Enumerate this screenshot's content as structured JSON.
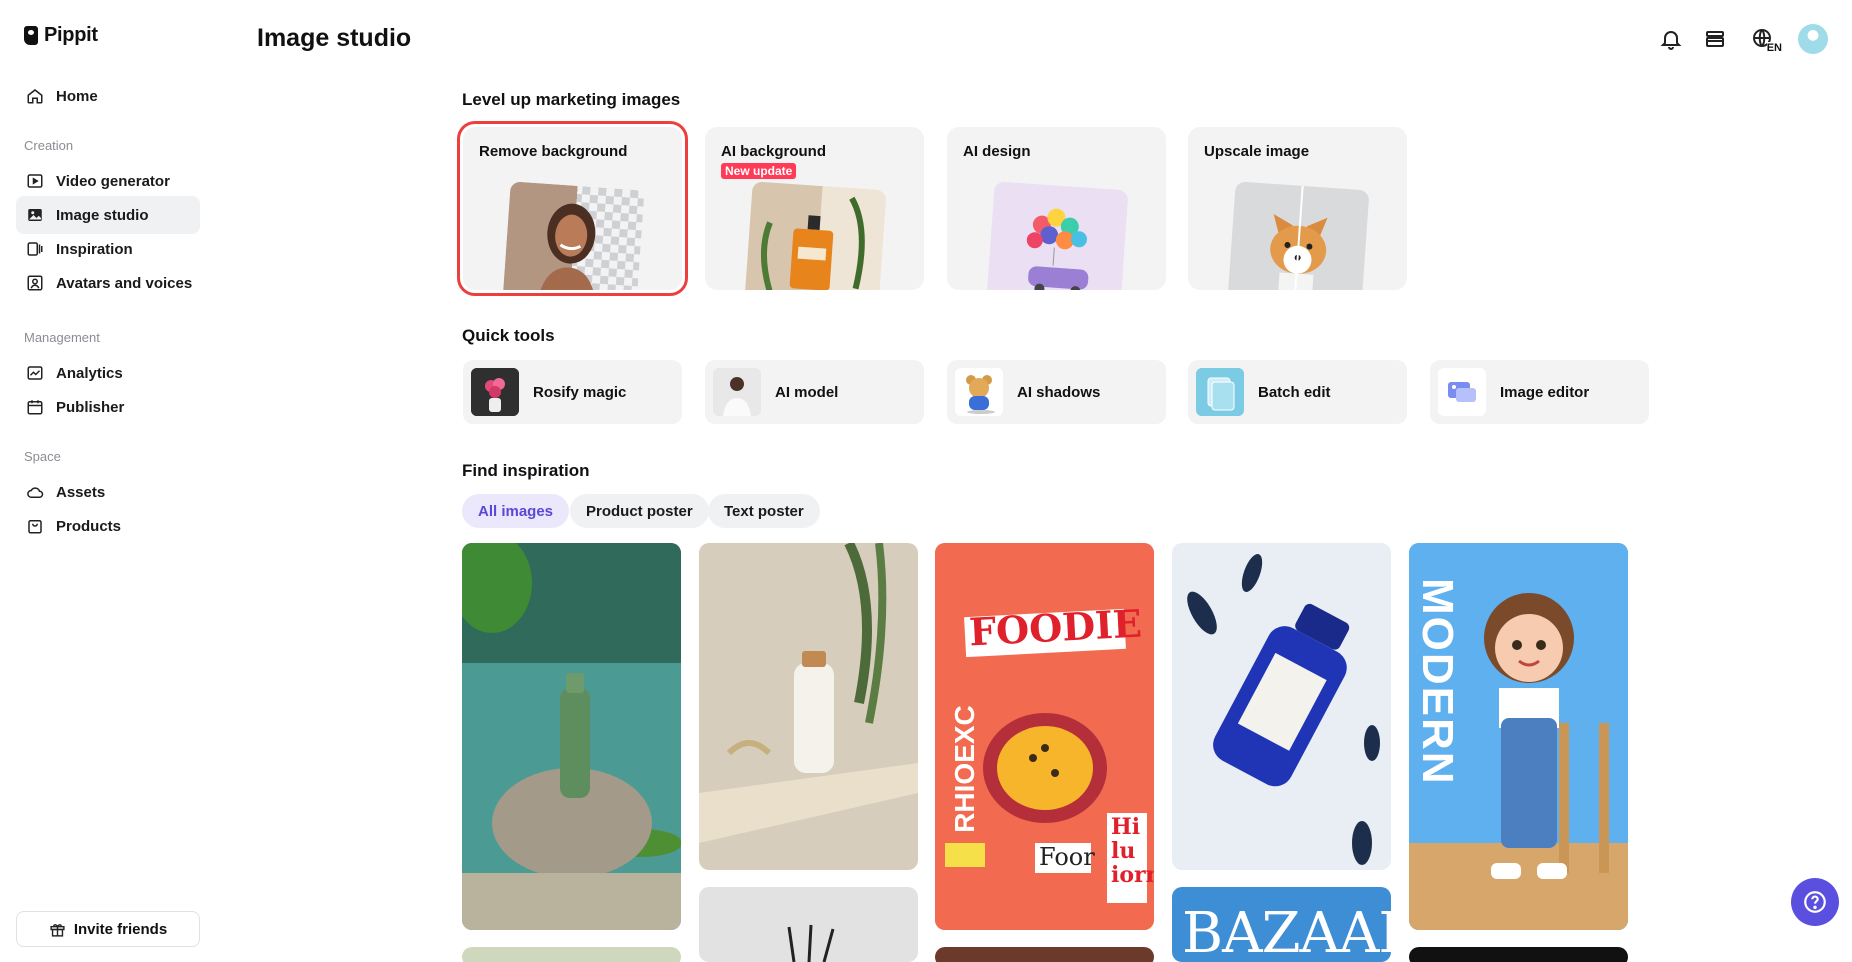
{
  "brand": {
    "name": "Pippit"
  },
  "sidebar": {
    "home": "Home",
    "sections": {
      "creation": "Creation",
      "management": "Management",
      "space": "Space"
    },
    "items": {
      "video_generator": "Video generator",
      "image_studio": "Image studio",
      "inspiration": "Inspiration",
      "avatars_voices": "Avatars and voices",
      "analytics": "Analytics",
      "publisher": "Publisher",
      "assets": "Assets",
      "products": "Products"
    },
    "invite": "Invite friends"
  },
  "header": {
    "title": "Image studio",
    "language": "EN"
  },
  "marketing": {
    "title": "Level up marketing images",
    "cards": [
      {
        "label": "Remove background"
      },
      {
        "label": "AI background",
        "badge": "New update"
      },
      {
        "label": "AI design"
      },
      {
        "label": "Upscale image"
      }
    ]
  },
  "quick_tools": {
    "title": "Quick tools",
    "items": [
      "Rosify magic",
      "AI model",
      "AI shadows",
      "Batch edit",
      "Image editor"
    ]
  },
  "inspiration": {
    "title": "Find inspiration",
    "filters": [
      "All images",
      "Product poster",
      "Text poster"
    ],
    "poster_texts": {
      "foodie": "FOODIE",
      "rhioexc": "RHIOEXC",
      "foor": "Foor",
      "hi_lu_iorn": "Hi lu iorn",
      "modern": "MODERN",
      "bazaar": "BAZAAR"
    }
  },
  "colors": {
    "accent": "#5b4fe0",
    "highlight": "#ee3f3f",
    "badge": "#ff3b58"
  }
}
